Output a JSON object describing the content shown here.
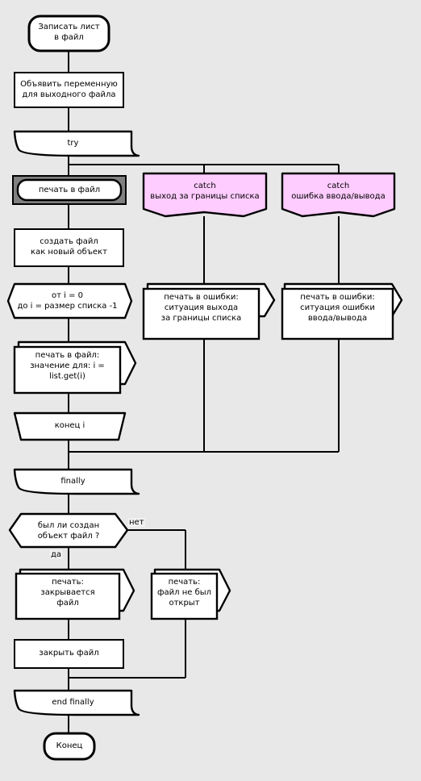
{
  "diagram": {
    "title": "Flowchart: Write list to file (try / catch / finally)",
    "language": "ru",
    "background_color": "#e8e8e8",
    "stroke_color": "#000000",
    "fill_default": "#ffffff",
    "fill_exception": "#ffccff",
    "highlight_border_color": "#808080"
  },
  "nodes": {
    "start": {
      "id": "start",
      "shape": "terminator",
      "label": "Записать лист\nв файл",
      "line1": "Записать лист",
      "line2": "в файл",
      "fill": "#ffffff"
    },
    "declare": {
      "id": "declare",
      "shape": "process",
      "label": "Объявить переменную\nдля выходного файла",
      "line1": "Объявить переменную",
      "line2": "для выходного файла",
      "fill": "#ffffff"
    },
    "try": {
      "id": "try",
      "shape": "banner",
      "label": "try",
      "fill": "#ffffff"
    },
    "print_to_file_title": {
      "id": "print_to_file_title",
      "shape": "rounded-highlight",
      "label": "печать в файл",
      "fill": "#ffffff",
      "frame_fill": "#808080"
    },
    "catch_index": {
      "id": "catch_index",
      "shape": "catch-banner",
      "label": "catch\nвыход за границы списка",
      "line1": "catch",
      "line2": "выход за границы списка",
      "fill": "#ffccff"
    },
    "catch_io": {
      "id": "catch_io",
      "shape": "catch-banner",
      "label": "catch\nошибка ввода/вывода",
      "line1": "catch",
      "line2": "ошибка ввода/вывода",
      "fill": "#ffccff"
    },
    "create_file": {
      "id": "create_file",
      "shape": "process",
      "label": "создать файл\nкак новый объект",
      "line1": "создать файл",
      "line2": "как новый объект",
      "fill": "#ffffff"
    },
    "err_print_index": {
      "id": "err_print_index",
      "shape": "output",
      "label": "печать в ошибки:\nситуация выхода\nза границы списка",
      "line1": "печать в ошибки:",
      "line2": "ситуация выхода",
      "line3": "за границы списка",
      "fill": "#ffffff"
    },
    "err_print_io": {
      "id": "err_print_io",
      "shape": "output",
      "label": "печать в ошибки:\nситуация ошибки\nввода/вывода",
      "line1": "печать в ошибки:",
      "line2": "ситуация ошибки",
      "line3": "ввода/вывода",
      "fill": "#ffffff"
    },
    "loop_start": {
      "id": "loop_start",
      "shape": "loop-start",
      "label": "от i = 0\nдо i = размер списка -1",
      "line1": "от i = 0",
      "line2": "до i = размер списка -1",
      "fill": "#ffffff"
    },
    "print_value": {
      "id": "print_value",
      "shape": "output",
      "label": "печать в файл:\nзначение для: i =\nlist.get(i)",
      "line1": "печать в файл:",
      "line2": "значение для: i =",
      "line3": "list.get(i)",
      "fill": "#ffffff"
    },
    "loop_end": {
      "id": "loop_end",
      "shape": "loop-end",
      "label": "конец i",
      "fill": "#ffffff"
    },
    "finally": {
      "id": "finally",
      "shape": "banner",
      "label": "finally",
      "fill": "#ffffff"
    },
    "decision": {
      "id": "decision",
      "shape": "decision-hex",
      "label": "был ли создан\nобъект файл ?",
      "line1": "был ли создан",
      "line2": "объект файл ?",
      "fill": "#ffffff"
    },
    "print_closing": {
      "id": "print_closing",
      "shape": "output",
      "label": "печать:\nзакрывается\nфайл",
      "line1": "печать:",
      "line2": "закрывается",
      "line3": "файл",
      "fill": "#ffffff"
    },
    "print_not_open": {
      "id": "print_not_open",
      "shape": "output",
      "label": "печать:\nфайл не был\nоткрыт",
      "line1": "печать:",
      "line2": "файл не был",
      "line3": "открыт",
      "fill": "#ffffff"
    },
    "close_file": {
      "id": "close_file",
      "shape": "process",
      "label": "закрыть файл",
      "fill": "#ffffff"
    },
    "end_finally": {
      "id": "end_finally",
      "shape": "banner",
      "label": "end finally",
      "fill": "#ffffff"
    },
    "end": {
      "id": "end",
      "shape": "terminator",
      "label": "Конец",
      "fill": "#ffffff"
    }
  },
  "edge_labels": {
    "no_branch": "нет",
    "yes_branch": "да"
  }
}
